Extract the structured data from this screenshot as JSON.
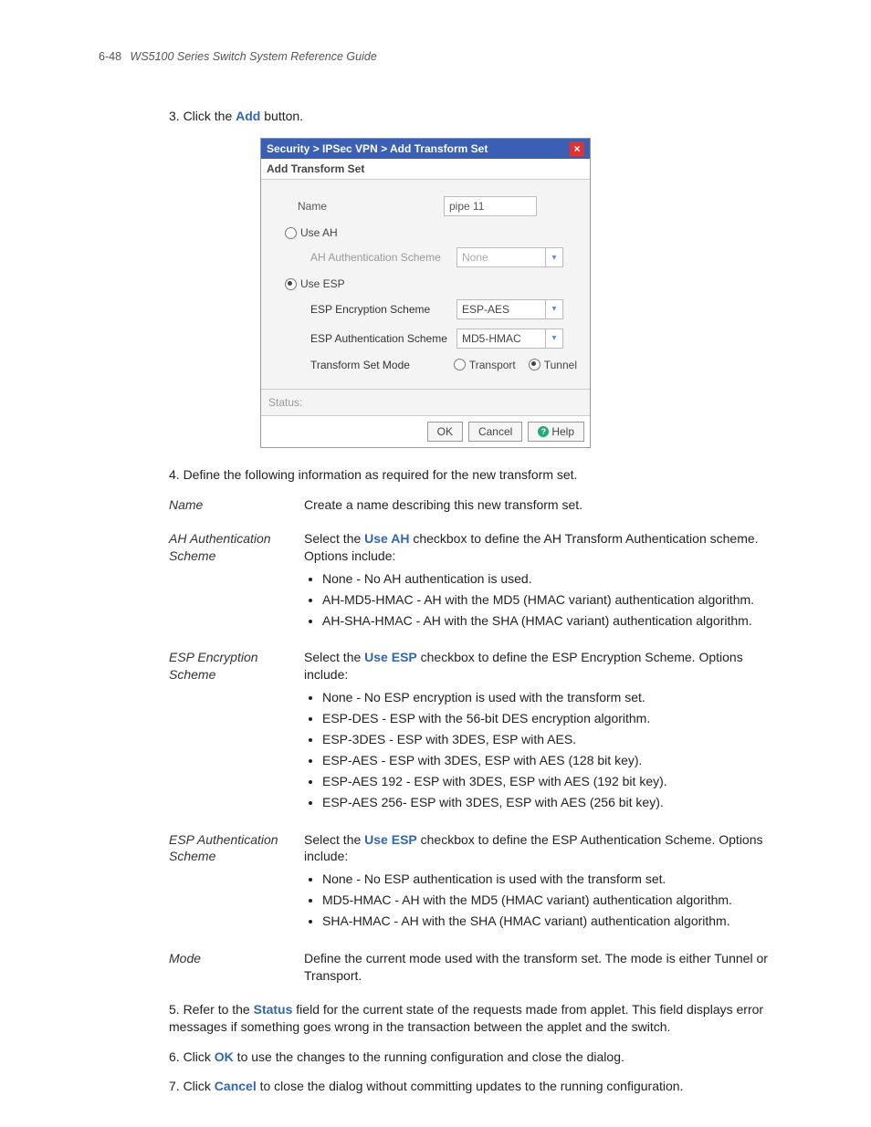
{
  "header": {
    "page_number": "6-48",
    "guide_title": "WS5100 Series Switch System Reference Guide"
  },
  "step3": {
    "prefix": "3. Click the ",
    "button": "Add",
    "suffix": " button."
  },
  "dialog": {
    "title_path": "Security > IPSec VPN > Add Transform Set",
    "subtitle": "Add Transform Set",
    "name_label": "Name",
    "name_value": "pipe 11",
    "use_ah_label": "Use AH",
    "ah_auth_label": "AH Authentication Scheme",
    "ah_auth_value": "None",
    "use_esp_label": "Use ESP",
    "esp_enc_label": "ESP Encryption Scheme",
    "esp_enc_value": "ESP-AES",
    "esp_auth_label": "ESP Authentication Scheme",
    "esp_auth_value": "MD5-HMAC",
    "mode_label": "Transform Set Mode",
    "mode_transport": "Transport",
    "mode_tunnel": "Tunnel",
    "status_label": "Status:",
    "ok": "OK",
    "cancel": "Cancel",
    "help": "Help"
  },
  "step4": {
    "text": "4. Define the following information as required for the new transform set."
  },
  "defs": {
    "name_term": "Name",
    "name_desc": "Create a name describing this new transform set.",
    "ah_term": "AH Authentication Scheme",
    "ah_intro_pre": "Select the ",
    "ah_intro_bold": "Use AH",
    "ah_intro_post": " checkbox to define the AH Transform Authentication scheme. Options include:",
    "ah_b1": "None - No AH authentication is used.",
    "ah_b2": "AH-MD5-HMAC - AH with the MD5 (HMAC variant) authentication algorithm.",
    "ah_b3": "AH-SHA-HMAC - AH with the SHA (HMAC variant) authentication algorithm.",
    "espenc_term": "ESP Encryption Scheme",
    "espenc_intro_pre": "Select the ",
    "espenc_intro_bold": "Use ESP",
    "espenc_intro_post": " checkbox to define the ESP Encryption Scheme. Options include:",
    "espenc_b1": "None - No ESP encryption is used with the transform set.",
    "espenc_b2": "ESP-DES - ESP with the 56-bit DES encryption algorithm.",
    "espenc_b3": "ESP-3DES - ESP with 3DES, ESP with AES.",
    "espenc_b4": "ESP-AES - ESP with 3DES, ESP with AES (128 bit key).",
    "espenc_b5": "ESP-AES 192 - ESP with 3DES, ESP with AES (192 bit key).",
    "espenc_b6": "ESP-AES 256- ESP with 3DES, ESP with AES (256 bit key).",
    "espauth_term": "ESP Authentication Scheme",
    "espauth_intro_pre": "Select the ",
    "espauth_intro_bold": "Use ESP",
    "espauth_intro_post": " checkbox to define the ESP Authentication Scheme. Options include:",
    "espauth_b1": "None - No ESP authentication is used with the transform set.",
    "espauth_b2": "MD5-HMAC - AH with the MD5 (HMAC variant) authentication algorithm.",
    "espauth_b3": "SHA-HMAC - AH with the SHA (HMAC variant) authentication algorithm.",
    "mode_term": "Mode",
    "mode_desc": "Define the current mode used with the transform set. The mode is either Tunnel or Transport."
  },
  "step5": {
    "pre": "5. Refer to the ",
    "bold": "Status",
    "post": " field for the current state of the requests made from applet. This field displays error messages if something goes wrong in the transaction between the applet and the switch."
  },
  "step6": {
    "pre": "6. Click ",
    "bold": "OK",
    "post": " to use the changes to the running configuration and close the dialog."
  },
  "step7": {
    "pre": "7. Click ",
    "bold": "Cancel",
    "post": " to close the dialog without committing updates to the running configuration."
  }
}
